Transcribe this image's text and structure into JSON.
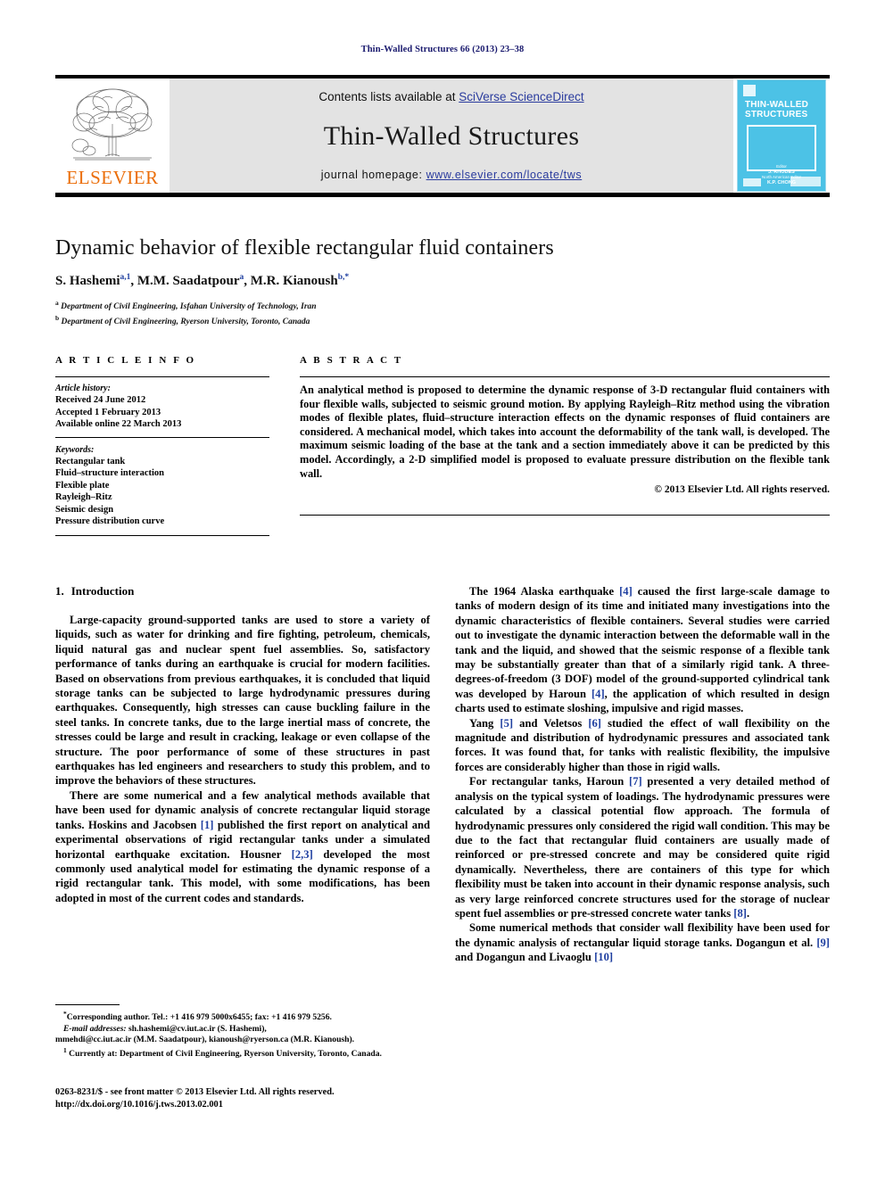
{
  "running_head": "Thin-Walled Structures 66 (2013) 23–38",
  "masthead": {
    "publisher_name": "ELSEVIER",
    "publisher_logo_icon": "elsevier-tree-icon",
    "contents_prefix": "Contents lists available at ",
    "contents_link": "SciVerse ScienceDirect",
    "journal_name": "Thin-Walled Structures",
    "homepage_prefix": "journal homepage: ",
    "homepage_link": "www.elsevier.com/locate/tws",
    "cover": {
      "title_line1": "THIN-WALLED",
      "title_line2": "STRUCTURES",
      "editor_label": "Editor",
      "editor_name": "J. RHODES",
      "assoc_label": "North American Editor",
      "assoc_name": "K.P. CHONG",
      "bg_color": "#4cc2e6"
    }
  },
  "title_block": {
    "title": "Dynamic behavior of flexible rectangular fluid containers",
    "authors": [
      {
        "name": "S. Hashemi",
        "marks": "a,1"
      },
      {
        "name": "M.M. Saadatpour",
        "marks": "a"
      },
      {
        "name": "M.R. Kianoush",
        "marks": "b,*"
      }
    ],
    "affiliations": [
      {
        "mark": "a",
        "text": "Department of Civil Engineering, Isfahan University of Technology, Iran"
      },
      {
        "mark": "b",
        "text": "Department of Civil Engineering, Ryerson University, Toronto, Canada"
      }
    ]
  },
  "article_info": {
    "heading": "A R T I C L E   I N F O",
    "history_label": "Article history:",
    "history": [
      "Received 24 June 2012",
      "Accepted 1 February 2013",
      "Available online 22 March 2013"
    ],
    "keywords_label": "Keywords:",
    "keywords": [
      "Rectangular tank",
      "Fluid–structure interaction",
      "Flexible plate",
      "Rayleigh–Ritz",
      "Seismic design",
      "Pressure distribution curve"
    ]
  },
  "abstract": {
    "heading": "A B S T R A C T",
    "text": "An analytical method is proposed to determine the dynamic response of 3-D rectangular fluid containers with four flexible walls, subjected to seismic ground motion. By applying Rayleigh–Ritz method using the vibration modes of flexible plates, fluid–structure interaction effects on the dynamic responses of fluid containers are considered. A mechanical model, which takes into account the deformability of the tank wall, is developed. The maximum seismic loading of the base at the tank and a section immediately above it can be predicted by this model. Accordingly, a 2-D simplified model is proposed to evaluate pressure distribution on the flexible tank wall.",
    "copyright": "© 2013 Elsevier Ltd. All rights reserved."
  },
  "body": {
    "section_number": "1.",
    "section_title": "Introduction",
    "left_paragraphs": [
      "Large-capacity ground-supported tanks are used to store a variety of liquids, such as water for drinking and fire fighting, petroleum, chemicals, liquid natural gas and nuclear spent fuel assemblies. So, satisfactory performance of tanks during an earthquake is crucial for modern facilities. Based on observations from previous earthquakes, it is concluded that liquid storage tanks can be subjected to large hydrodynamic pressures during earthquakes. Consequently, high stresses can cause buckling failure in the steel tanks. In concrete tanks, due to the large inertial mass of concrete, the stresses could be large and result in cracking, leakage or even collapse of the structure. The poor performance of some of these structures in past earthquakes has led engineers and researchers to study this problem, and to improve the behaviors of these structures."
    ],
    "left_paragraph2_parts": [
      "There are some numerical and a few analytical methods available that have been used for dynamic analysis of concrete rectangular liquid storage tanks. Hoskins and Jacobsen ",
      "[1]",
      " published the first report on analytical and experimental observations of rigid rectangular tanks under a simulated horizontal earthquake excitation. Housner ",
      "[2,3]",
      " developed the most commonly used analytical model for estimating the dynamic response of a rigid rectangular tank. This model, with some modifications, has been adopted in most of the current codes and standards."
    ],
    "right_paragraph1_parts": [
      "The 1964 Alaska earthquake ",
      "[4]",
      " caused the first large-scale damage to tanks of modern design of its time and initiated many investigations into the dynamic characteristics of flexible containers. Several studies were carried out to investigate the dynamic interaction between the deformable wall in the tank and the liquid, and showed that the seismic response of a flexible tank may be substantially greater than that of a similarly rigid tank. A three-degrees-of-freedom (3 DOF) model of the ground-supported cylindrical tank was developed by Haroun ",
      "[4]",
      ", the application of which resulted in design charts used to estimate sloshing, impulsive and rigid masses."
    ],
    "right_paragraph2_parts": [
      "Yang ",
      "[5]",
      " and Veletsos ",
      "[6]",
      " studied the effect of wall flexibility on the magnitude and distribution of hydrodynamic pressures and associated tank forces. It was found that, for tanks with realistic flexibility, the impulsive forces are considerably higher than those in rigid walls."
    ],
    "right_paragraph3_parts": [
      "For rectangular tanks, Haroun ",
      "[7]",
      " presented a very detailed method of analysis on the typical system of loadings. The hydrodynamic pressures were calculated by a classical potential flow approach. The formula of hydrodynamic pressures only considered the rigid wall condition. This may be due to the fact that rectangular fluid containers are usually made of reinforced or pre-stressed concrete and may be considered quite rigid dynamically. Nevertheless, there are containers of this type for which flexibility must be taken into account in their dynamic response analysis, such as very large reinforced concrete structures used for the storage of nuclear spent fuel assemblies or pre-stressed concrete water tanks ",
      "[8]",
      "."
    ],
    "right_paragraph4_parts": [
      "Some numerical methods that consider wall flexibility have been used for the dynamic analysis of rectangular liquid storage tanks. Dogangun et al. ",
      "[9]",
      " and Dogangun and Livaoglu ",
      "[10]"
    ]
  },
  "footnotes": {
    "corresponding": "Corresponding author. Tel.: +1 416 979 5000x6455; fax: +1 416 979 5256.",
    "email_label": "E-mail addresses:",
    "email_line1": " sh.hashemi@cv.iut.ac.ir (S. Hashemi),",
    "email_line2": "mmehdi@cc.iut.ac.ir (M.M. Saadatpour), kianoush@ryerson.ca (M.R. Kianoush).",
    "currently_mark": "1",
    "currently": " Currently at: Department of Civil Engineering, Ryerson University, Toronto, Canada."
  },
  "imprint": {
    "line1": "0263-8231/$ - see front matter © 2013 Elsevier Ltd. All rights reserved.",
    "line2": "http://dx.doi.org/10.1016/j.tws.2013.02.001"
  }
}
